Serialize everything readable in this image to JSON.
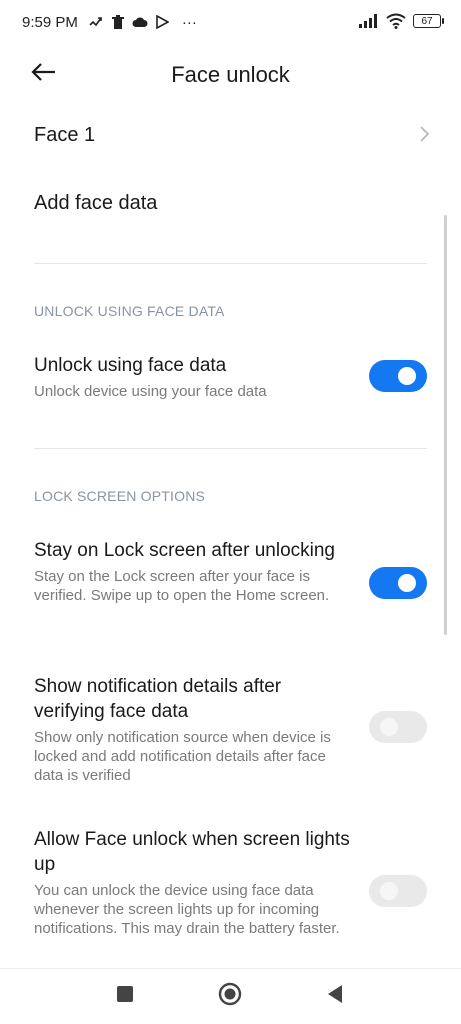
{
  "status_bar": {
    "time": "9:59 PM",
    "more": "···",
    "battery": "67",
    "icons_left": [
      "phone-missed-icon",
      "trash-icon",
      "cloud-icon",
      "play-store-icon"
    ],
    "icons_right": [
      "signal-icon",
      "wifi-icon",
      "battery-icon"
    ]
  },
  "header": {
    "title": "Face unlock",
    "back_icon": "back-arrow-icon"
  },
  "face_entry": {
    "label": "Face 1"
  },
  "add_face": {
    "label": "Add face data"
  },
  "sections": {
    "unlock": {
      "header": "UNLOCK USING FACE DATA"
    },
    "lock_screen": {
      "header": "LOCK SCREEN OPTIONS"
    }
  },
  "settings": {
    "unlock_face": {
      "title": "Unlock using face data",
      "desc": "Unlock device using your face data",
      "enabled": true
    },
    "stay_lock": {
      "title": "Stay on Lock screen after unlocking",
      "desc": "Stay on the Lock screen after your face is verified. Swipe up to open the Home screen.",
      "enabled": true
    },
    "show_notif": {
      "title": "Show notification details after verifying face data",
      "desc": "Show only notification source when device is locked and add notification details after face data is verified",
      "enabled": false
    },
    "allow_lights": {
      "title": "Allow Face unlock when screen lights up",
      "desc": "You can unlock the device using face data whenever the screen lights up for incoming notifications. This may drain the battery faster.",
      "enabled": false
    }
  },
  "nav": {
    "recents_icon": "square-icon",
    "home_icon": "circle-icon",
    "back_icon": "triangle-back-icon"
  },
  "colors": {
    "accent": "#1478f0",
    "toggle_off": "#e9e9e9",
    "section_header": "#8a93a3",
    "secondary_text": "#7a7a7a"
  }
}
